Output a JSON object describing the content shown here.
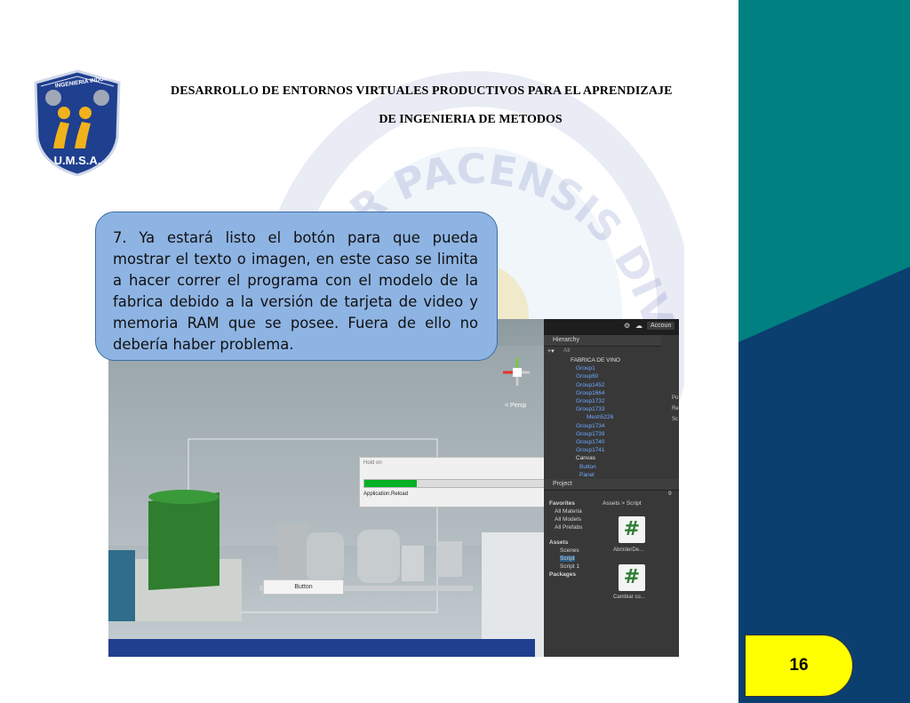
{
  "header": {
    "title_line1": "DESARROLLO DE ENTORNOS VIRTUALES PRODUCTIVOS PARA EL APRENDIZAJE",
    "title_line2": "DE INGENIERIA DE METODOS"
  },
  "logo": {
    "arc_text": "INGENIERIA INDUSTRIAL",
    "bottom_text": "U.M.S.A."
  },
  "watermark": {
    "text": "MAJOR PACENSIS DIVI"
  },
  "callout": {
    "text": "7. Ya estará listo el botón para que pueda mostrar el texto o imagen, en este caso se limita a hacer correr el programa con el modelo de la fabrica debido a la versión de tarjeta de video y memoria RAM que se posee. Fuera de ello no debería haber problema."
  },
  "unity": {
    "account_label": "Accoun",
    "persp_label": "< Persp",
    "dialog": {
      "title": "Hold on",
      "message": "Application.Reload",
      "progress": 0.28
    },
    "button_label": "Button",
    "hierarchy": {
      "tab": "Hierarchy",
      "search": "All",
      "items": [
        "FABRICA DE VINO",
        "Group1",
        "Group60",
        "Group1452",
        "Group1664",
        "Group1732",
        "Group1733",
        "Mesh5226",
        "Group1734",
        "Group1739",
        "Group1740",
        "Group1741",
        "Canvas",
        "Button",
        "Panel"
      ]
    },
    "project": {
      "tab": "Project",
      "favorites_label": "Favorites",
      "favorites": [
        "All Materia",
        "All Models",
        "All Prefabs"
      ],
      "assets_label": "Assets",
      "assets": [
        "Scenes",
        "Script",
        "Script 1"
      ],
      "packages_label": "Packages",
      "breadcrumb": "Assets > Script",
      "files": [
        "AbrirderDe...",
        "Cambiar co..."
      ],
      "count": "9"
    },
    "inspector_letters": [
      "Po",
      "Re",
      "Sc"
    ]
  },
  "page": {
    "number": "16"
  },
  "colors": {
    "teal": "#008080",
    "navy": "#0a3f6f",
    "callout": "#8eb4e3",
    "page_tab": "#ffff00"
  }
}
